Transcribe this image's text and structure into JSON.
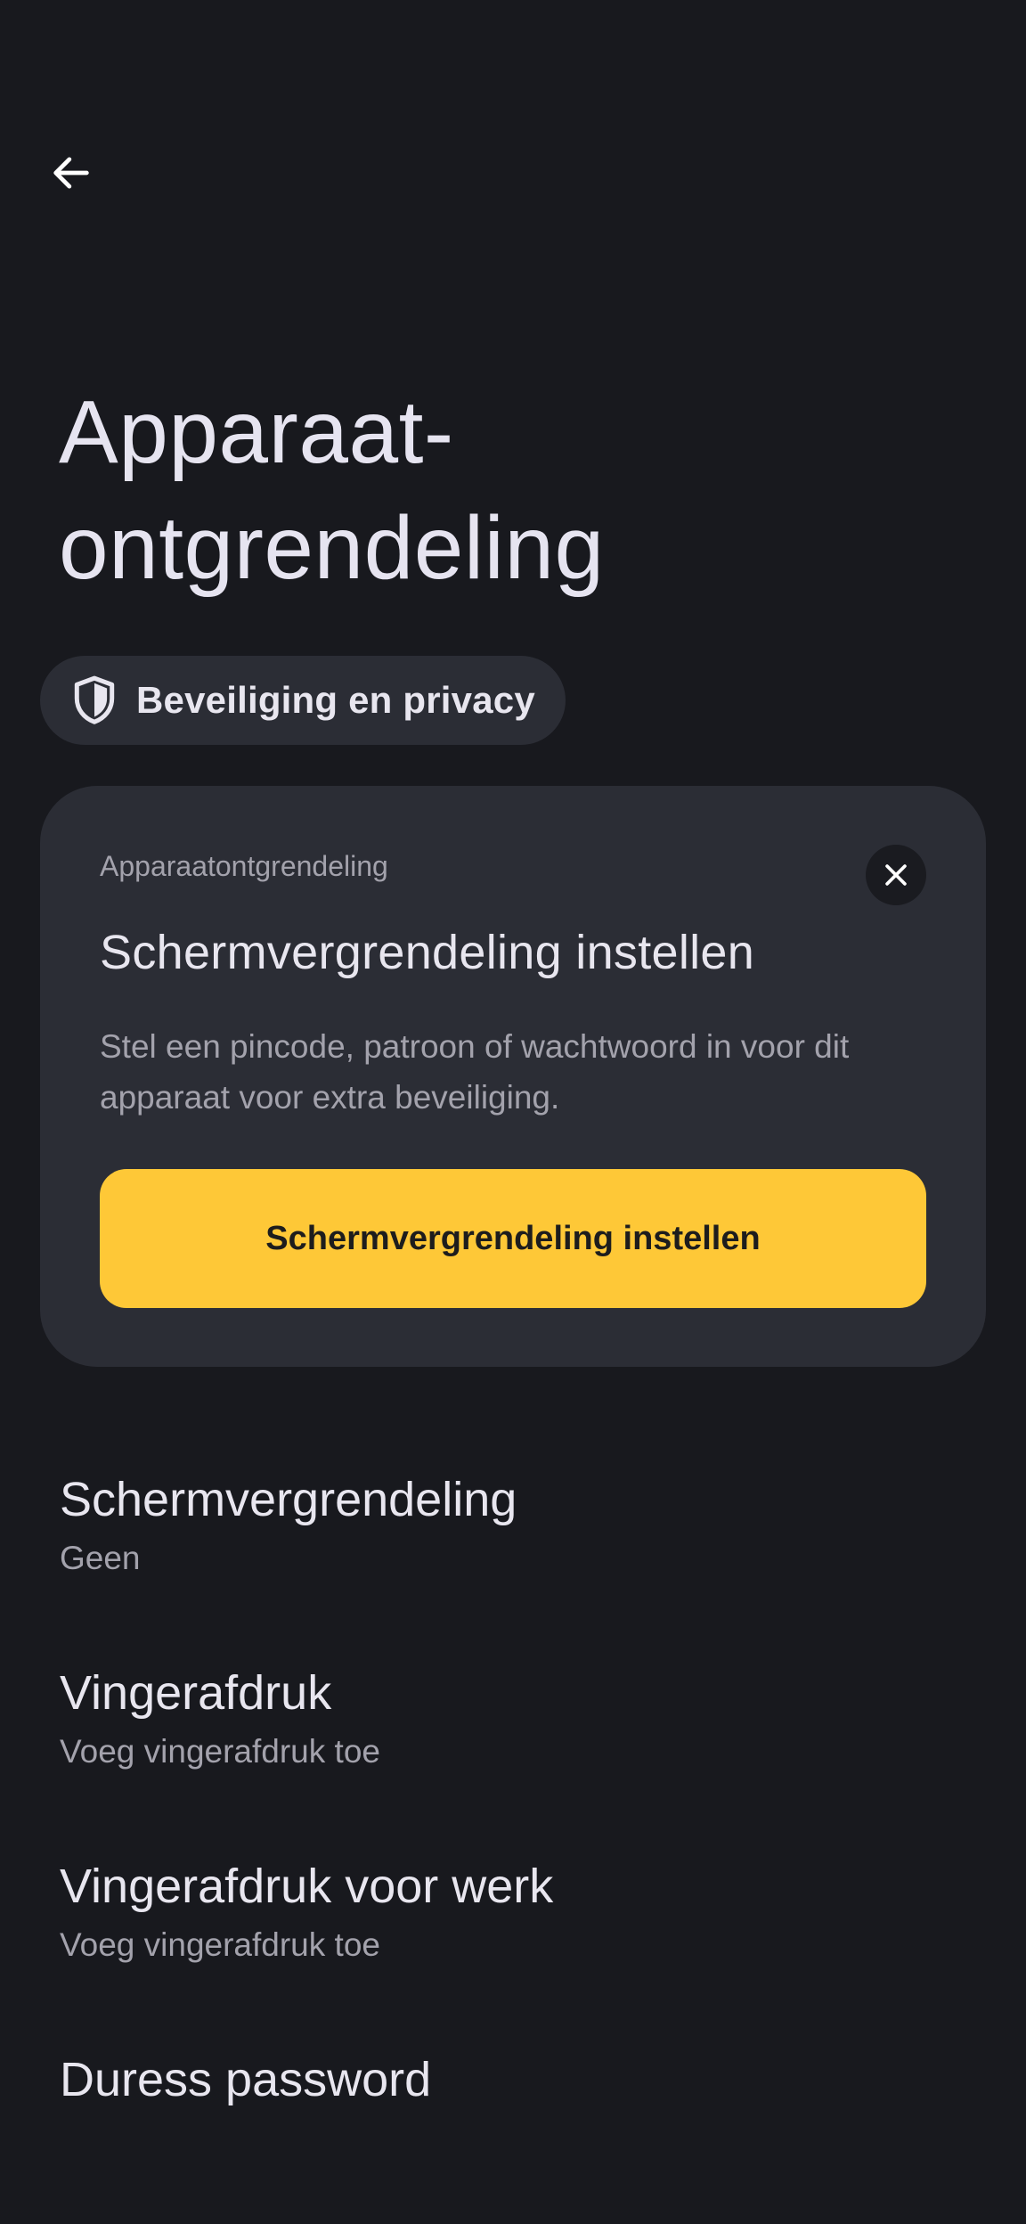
{
  "header": {
    "back_icon": "arrow-left-icon",
    "title_line1": "Apparaat-",
    "title_line2": "ontgrendeling"
  },
  "chip": {
    "icon": "shield-icon",
    "label": "Beveiliging en privacy"
  },
  "card": {
    "eyebrow": "Apparaatontgrendeling",
    "close_icon": "close-icon",
    "title": "Schermvergrendeling instellen",
    "body": "Stel een pincode, patroon of wachtwoord in voor dit apparaat voor extra beveiliging.",
    "button_label": "Schermvergrendeling instellen"
  },
  "settings": {
    "items": [
      {
        "title": "Schermvergrendeling",
        "subtitle": "Geen"
      },
      {
        "title": "Vingerafdruk",
        "subtitle": "Voeg vingerafdruk toe"
      },
      {
        "title": "Vingerafdruk voor werk",
        "subtitle": "Voeg vingerafdruk toe"
      },
      {
        "title": "Duress password",
        "subtitle": ""
      }
    ]
  },
  "colors": {
    "background": "#18191e",
    "surface": "#2b2d35",
    "accent": "#fec837",
    "text_primary": "#e8e6ef",
    "text_secondary": "#a3a2ac"
  }
}
